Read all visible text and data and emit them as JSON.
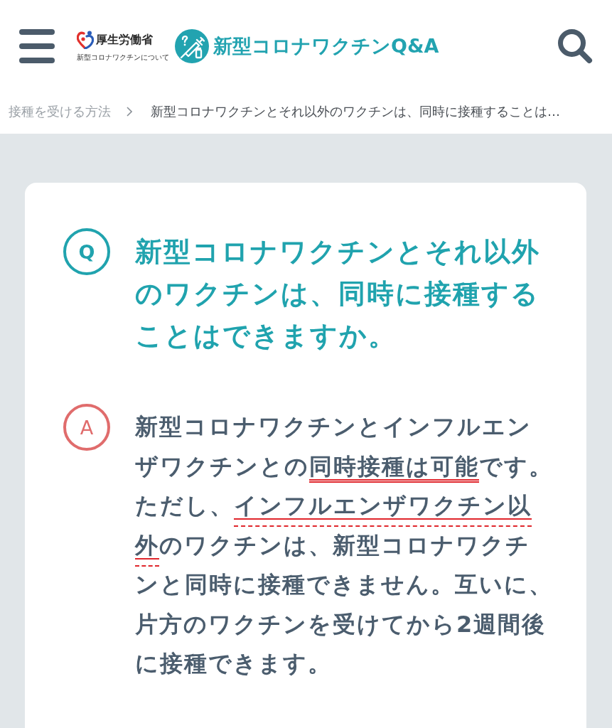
{
  "header": {
    "ministry_logo": {
      "name": "厚生労働省",
      "subtitle": "新型コロナワクチンについて"
    },
    "site_logo": {
      "title": "新型コロナワクチンQ&A"
    }
  },
  "breadcrumb": [
    {
      "label": "接種を受ける方法",
      "current": false
    },
    {
      "label": "新型コロナワクチンとそれ以外のワクチンは、同時に接種することは…",
      "current": true
    }
  ],
  "question": {
    "marker": "Q",
    "text": "新型コロナワクチンとそれ以外のワクチンは、同時に接種することはできますか。"
  },
  "answer": {
    "marker": "A",
    "segments": [
      {
        "text": "新型コロナワクチンとインフルエンザワクチンとの",
        "kind": "plain"
      },
      {
        "text": "同時接種は可能",
        "kind": "double"
      },
      {
        "text": "です。ただし、",
        "kind": "plain"
      },
      {
        "text": "インフルエンザワクチン以外",
        "kind": "dashed"
      },
      {
        "text": "のワクチンは、新型コロナワクチンと同時に接種できません。互いに、片方のワクチンを受けてから2週間後に接種できます。",
        "kind": "plain"
      }
    ]
  }
}
